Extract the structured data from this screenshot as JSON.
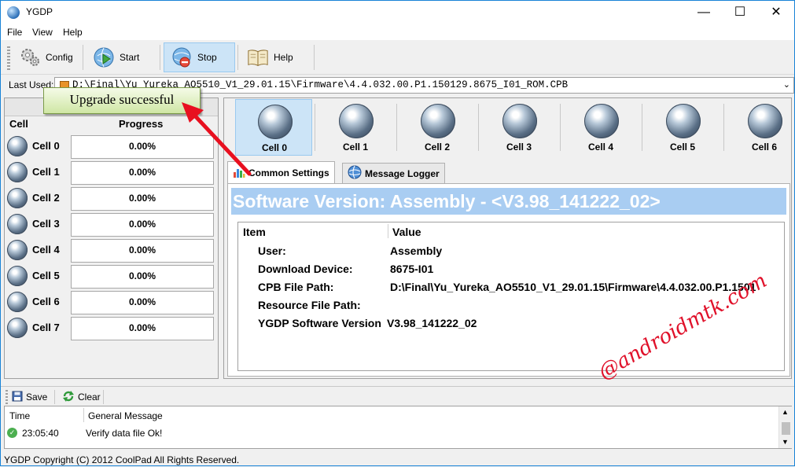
{
  "window": {
    "title": "YGDP"
  },
  "menu": [
    "File",
    "View",
    "Help"
  ],
  "toolbar": {
    "config_label": "Config",
    "start_label": "Start",
    "stop_label": "Stop",
    "help_label": "Help"
  },
  "last_used": {
    "label": "Last Used:",
    "value": "D:\\Final\\Yu_Yureka_AO5510_V1_29.01.15\\Firmware\\4.4.032.00.P1.150129.8675_I01_ROM.CPB"
  },
  "popup": {
    "text": "Upgrade successful"
  },
  "left_panel": {
    "col_cell": "Cell",
    "col_progress": "Progress",
    "rows": [
      {
        "label": "Cell 0",
        "progress": "0.00%"
      },
      {
        "label": "Cell 1",
        "progress": "0.00%"
      },
      {
        "label": "Cell 2",
        "progress": "0.00%"
      },
      {
        "label": "Cell 3",
        "progress": "0.00%"
      },
      {
        "label": "Cell 4",
        "progress": "0.00%"
      },
      {
        "label": "Cell 5",
        "progress": "0.00%"
      },
      {
        "label": "Cell 6",
        "progress": "0.00%"
      },
      {
        "label": "Cell 7",
        "progress": "0.00%"
      }
    ]
  },
  "cells": [
    "Cell 0",
    "Cell 1",
    "Cell 2",
    "Cell 3",
    "Cell 4",
    "Cell 5",
    "Cell 6"
  ],
  "selected_cell": "Cell 0",
  "tabs": {
    "common": "Common Settings",
    "logger": "Message Logger"
  },
  "software_banner": "Software Version:  Assembly - <V3.98_141222_02>",
  "info_table": {
    "col_item": "Item",
    "col_value": "Value",
    "rows": [
      {
        "key": "User:",
        "value": "Assembly"
      },
      {
        "key": "Download Device:",
        "value": "8675-I01"
      },
      {
        "key": "CPB File Path:",
        "value": "D:\\Final\\Yu_Yureka_AO5510_V1_29.01.15\\Firmware\\4.4.032.00.P1.1501"
      },
      {
        "key": "Resource File Path:",
        "value": ""
      },
      {
        "key": "YGDP Software Version",
        "value": "V3.98_141222_02"
      }
    ]
  },
  "log": {
    "save_label": "Save",
    "clear_label": "Clear",
    "col_time": "Time",
    "col_message": "General Message",
    "entries": [
      {
        "time": "23:05:40",
        "message": "Verify data file Ok!"
      }
    ]
  },
  "status_text": "YGDP Copyright (C) 2012 CoolPad All Rights Reserved.",
  "watermark": "@androidmtk.com",
  "colors": {
    "banner": "#a9cdf2",
    "accent": "#cce4f7",
    "arrow": "#e8101f",
    "watermark": "#e0112a"
  }
}
